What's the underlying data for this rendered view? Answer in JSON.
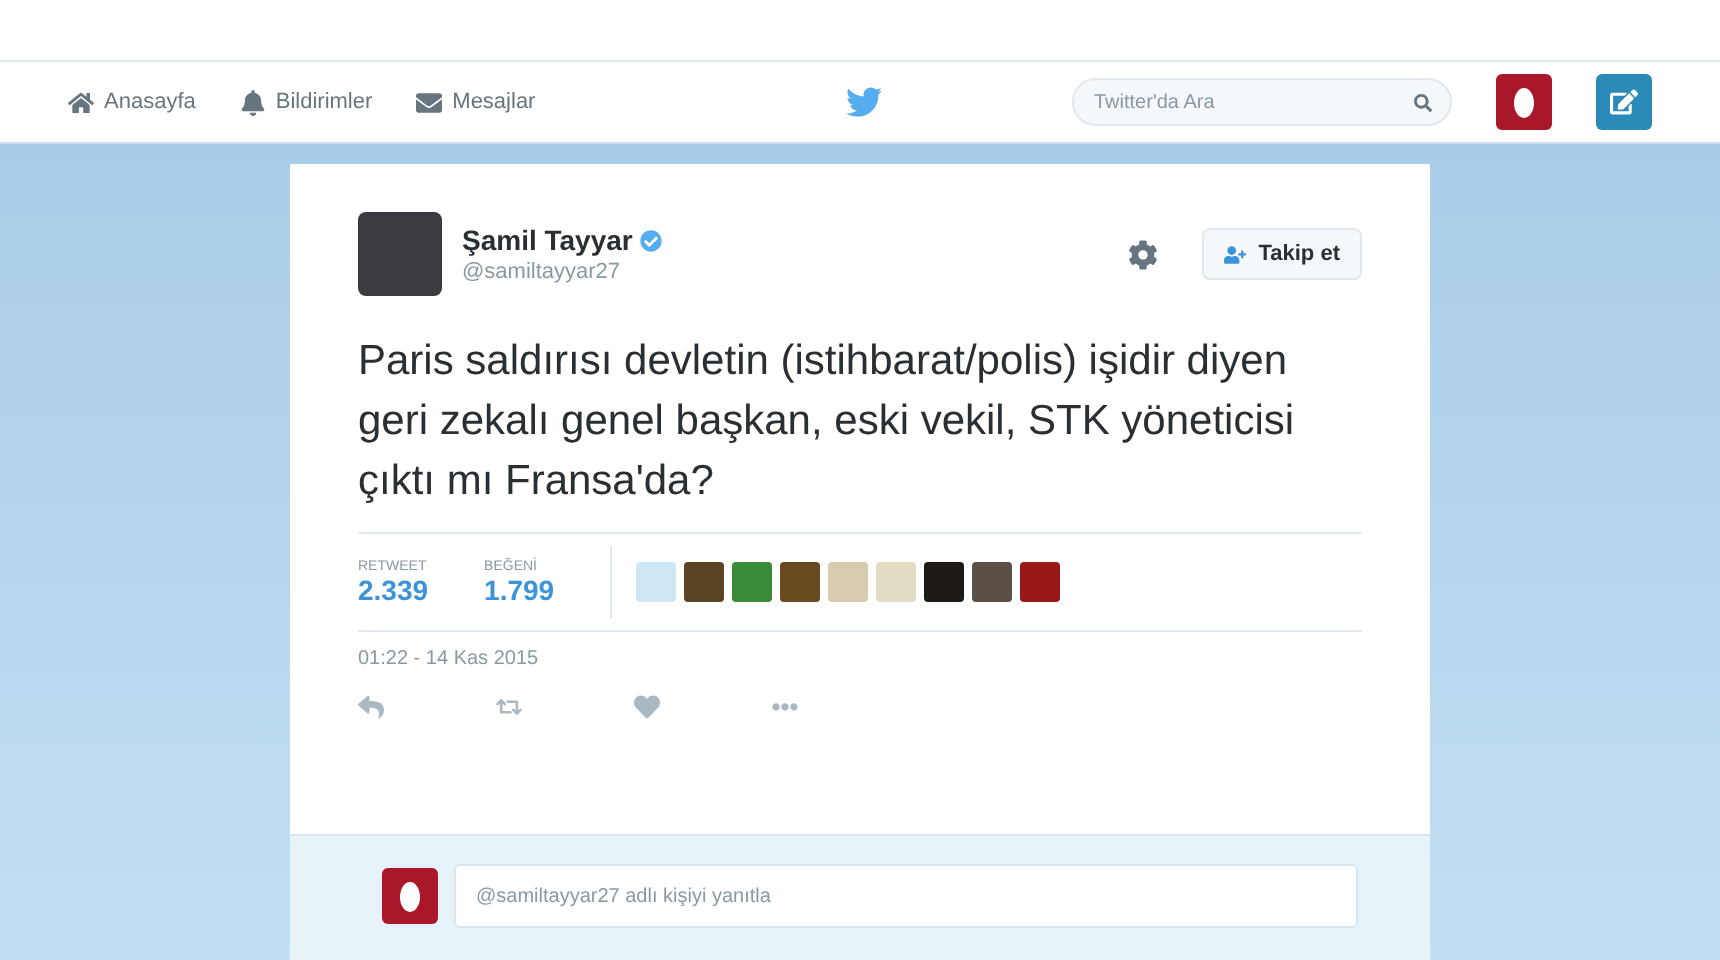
{
  "nav": {
    "items": [
      {
        "label": "Anasayfa"
      },
      {
        "label": "Bildirimler"
      },
      {
        "label": "Mesajlar"
      }
    ],
    "search": {
      "placeholder": "Twitter'da Ara"
    }
  },
  "tweet": {
    "author": {
      "name": "Şamil Tayyar",
      "handle": "@samiltayyar27",
      "verified": true
    },
    "follow_button": "Takip et",
    "text": "Paris saldırısı devletin (istihbarat/polis) işidir diyen geri zekalı genel başkan, eski vekil, STK yöneticisi çıktı mı Fransa'da?",
    "stats": [
      {
        "label": "RETWEET",
        "value": "2.339"
      },
      {
        "label": "BEĞENİ",
        "value": "1.799"
      }
    ],
    "time": "01:22 - 14 Kas 2015"
  },
  "reply": {
    "placeholder": "@samiltayyar27 adlı kişiyi yanıtla"
  }
}
